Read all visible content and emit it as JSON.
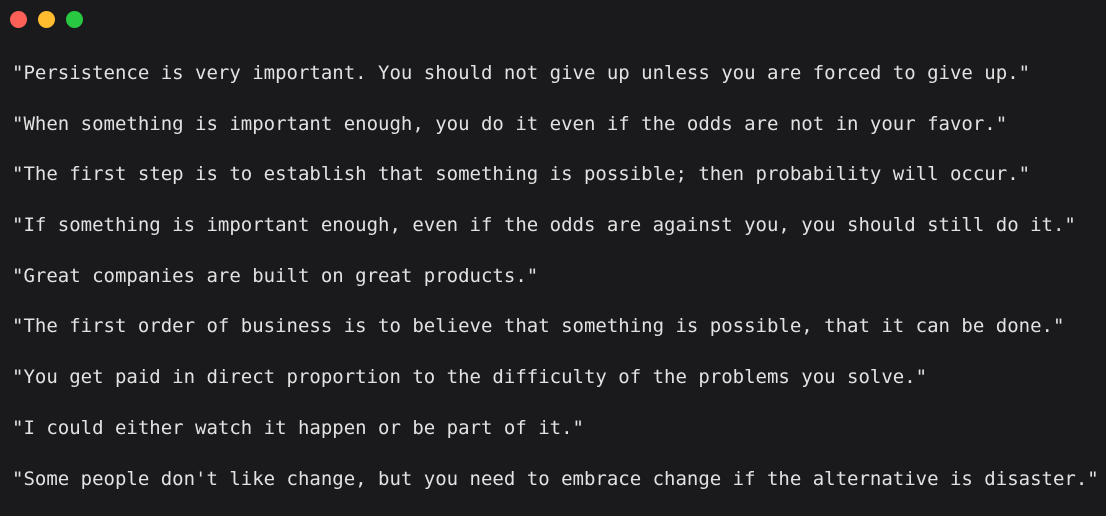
{
  "window": {
    "controls": [
      {
        "name": "close",
        "color": "#fe5f57"
      },
      {
        "name": "minimize",
        "color": "#febc2e"
      },
      {
        "name": "maximize",
        "color": "#28c840"
      }
    ]
  },
  "quotes": [
    "\"Persistence is very important. You should not give up unless you are forced to give up.\"",
    "\"When something is important enough, you do it even if the odds are not in your favor.\"",
    "\"The first step is to establish that something is possible; then probability will occur.\"",
    "\"If something is important enough, even if the odds are against you, you should still do it.\"",
    "\"Great companies are built on great products.\"",
    "\"The first order of business is to believe that something is possible, that it can be done.\"",
    "\"You get paid in direct proportion to the difficulty of the problems you solve.\"",
    "\"I could either watch it happen or be part of it.\"",
    "\"Some people don't like change, but you need to embrace change if the alternative is disaster.\""
  ]
}
